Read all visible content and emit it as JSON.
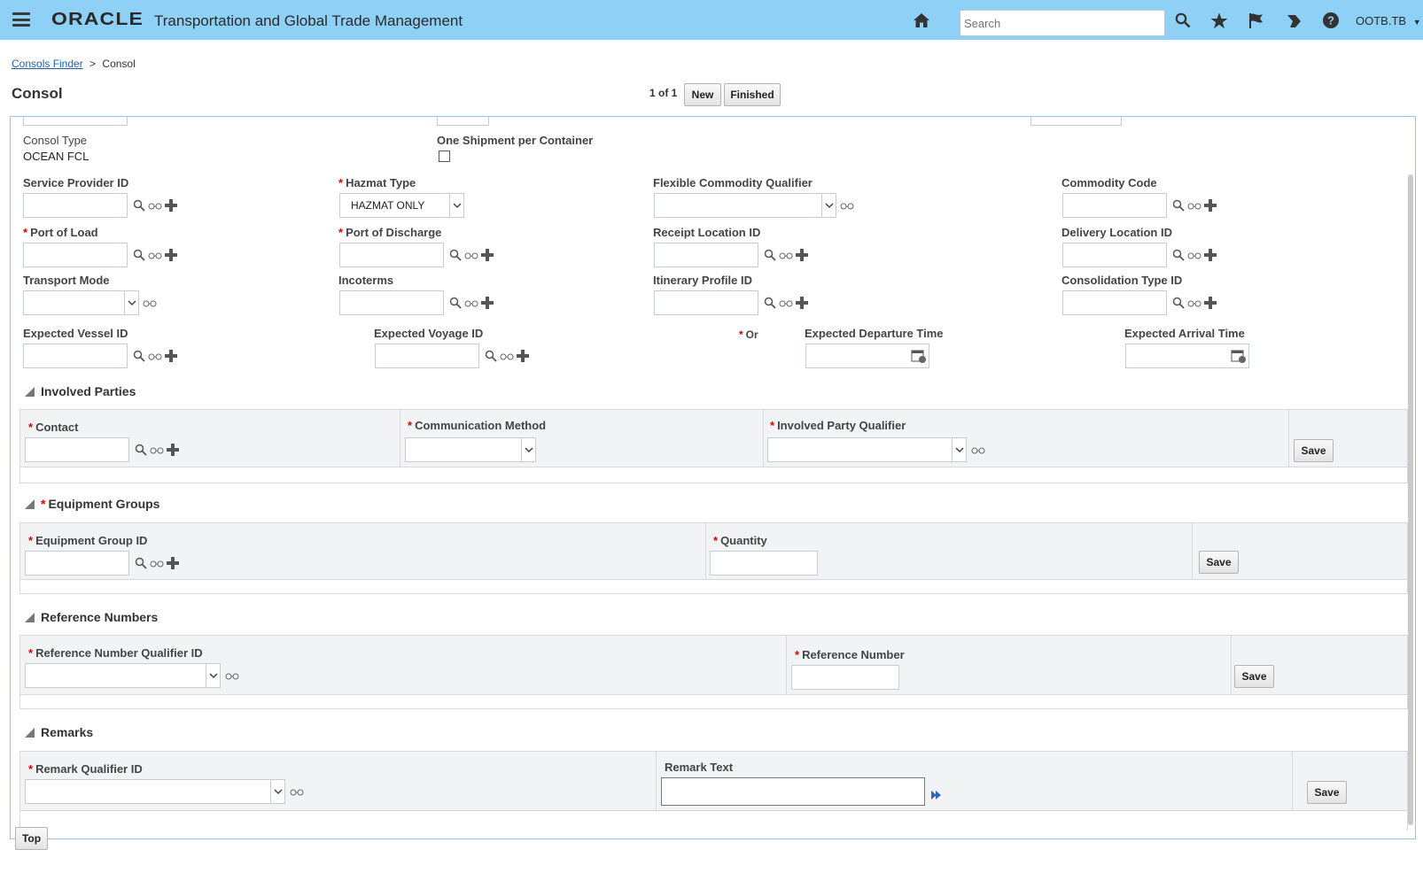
{
  "header": {
    "brand": "ORACLE",
    "title": "Transportation and Global Trade Management",
    "search_placeholder": "Search",
    "user": "OOTB.TB"
  },
  "breadcrumb": {
    "link": "Consols Finder",
    "separator": ">",
    "current": "Consol"
  },
  "page": {
    "title": "Consol",
    "pager": "1 of 1",
    "new_label": "New",
    "finished_label": "Finished",
    "top_label": "Top"
  },
  "form": {
    "consol_type_label": "Consol Type",
    "consol_type_value": "OCEAN FCL",
    "one_shipment_label": "One Shipment per Container",
    "service_provider_label": "Service Provider ID",
    "hazmat_type_label": "Hazmat Type",
    "hazmat_type_value": "HAZMAT ONLY",
    "flexible_commodity_label": "Flexible Commodity Qualifier",
    "commodity_code_label": "Commodity Code",
    "port_of_load_label": "Port of Load",
    "port_of_discharge_label": "Port of Discharge",
    "receipt_location_label": "Receipt Location ID",
    "delivery_location_label": "Delivery Location ID",
    "transport_mode_label": "Transport Mode",
    "incoterms_label": "Incoterms",
    "itinerary_profile_label": "Itinerary Profile ID",
    "consolidation_type_label": "Consolidation Type ID",
    "expected_vessel_label": "Expected Vessel ID",
    "expected_voyage_label": "Expected Voyage ID",
    "or_label": "Or",
    "expected_departure_label": "Expected Departure Time",
    "expected_arrival_label": "Expected Arrival Time",
    "required_mark": "*"
  },
  "sections": {
    "involved_parties": {
      "title": "Involved Parties",
      "contact_label": "Contact",
      "communication_method_label": "Communication Method",
      "involved_party_qualifier_label": "Involved Party Qualifier",
      "save_label": "Save"
    },
    "equipment_groups": {
      "title": "Equipment Groups",
      "equipment_group_id_label": "Equipment Group ID",
      "quantity_label": "Quantity",
      "save_label": "Save"
    },
    "reference_numbers": {
      "title": "Reference Numbers",
      "qualifier_label": "Reference Number Qualifier ID",
      "reference_number_label": "Reference Number",
      "save_label": "Save"
    },
    "remarks": {
      "title": "Remarks",
      "qualifier_label": "Remark Qualifier ID",
      "remark_text_label": "Remark Text",
      "save_label": "Save"
    }
  },
  "colors": {
    "header_bg": "#8fd0f7",
    "link": "#1f5fa8",
    "required": "#dd0000",
    "panel_border": "#9fc1de"
  }
}
